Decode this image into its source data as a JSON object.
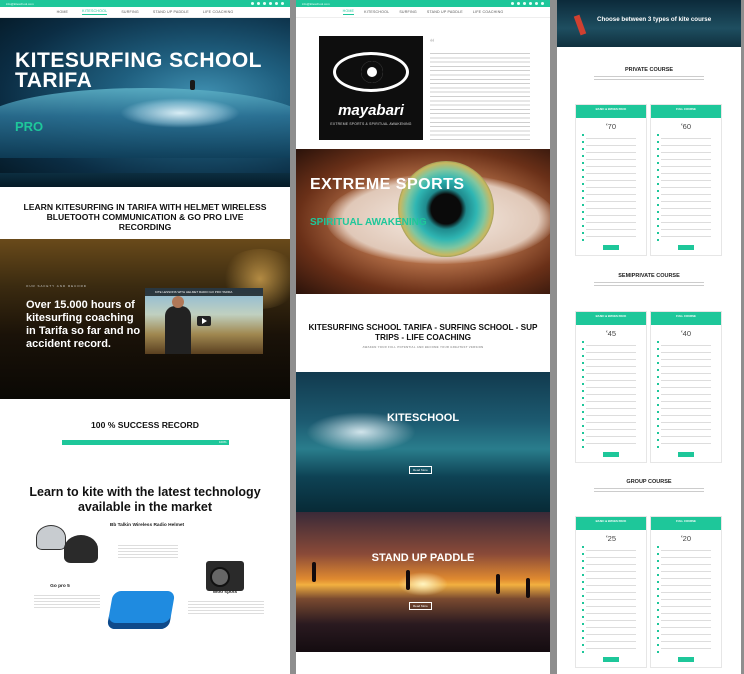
{
  "nav": {
    "email": "info@kiteschool.com",
    "items": [
      "HOME",
      "KITESCHOOL",
      "SURFING",
      "STAND UP PADDLE",
      "LIFE COACHING"
    ],
    "active_index_col1": 1,
    "active_index_col2": 0
  },
  "col1": {
    "hero_title": "KITESURFING SCHOOL TARIFA",
    "hero_pro": "PRO",
    "section_title": "LEARN KITESURFING IN TARIFA WITH HELMET WIRELESS BLUETOOTH COMMUNICATION & GO PRO LIVE RECORDING",
    "video_small": "OUR SAFETY AND RECORD",
    "video_text": "Over 15.000 hours of kitesurfing coaching in Tarifa so far and no accident record.",
    "video_bar_title": "KITE LESSONS WITH HELMET RADIO GO PRO TARIFA",
    "success_title": "100 % SUCCESS RECORD",
    "success_value": 1.0,
    "success_bar_label": "100%",
    "learn_title": "Learn to kite with the latest technology available in the market",
    "products": [
      {
        "name": "Bb Talkin Wireless Radio Helmet"
      },
      {
        "name": "Go pro 5"
      },
      {
        "name": "Woo spots"
      }
    ]
  },
  "col2": {
    "logo_word": "mayabari",
    "logo_tagline": "EXTREME SPORTS & SPIRITUAL AWAKENING",
    "eye_title": "EXTREME SPORTS",
    "eye_subtitle": "SPIRITUAL AWAKENING",
    "section_title": "KITESURFING SCHOOL TARIFA - SURFING SCHOOL - SUP TRIPS - LIFE COACHING",
    "section_sub": "AWAKEN YOUR FULL POTENTIAL AND BECOME YOUR GREATEST VERSION",
    "kite_title": "KITESCHOOL",
    "sup_title": "STAND UP PADDLE",
    "read_more": "Read More"
  },
  "col3": {
    "hero_title": "Choose between 3 types of kite course",
    "courses": [
      {
        "title": "PRIVATE COURSE",
        "prices": [
          {
            "label": "BASIC & WAVES PACK",
            "value": "70"
          },
          {
            "label": "FULL COURSE",
            "value": "60"
          }
        ]
      },
      {
        "title": "SEMIPRIVATE COURSE",
        "prices": [
          {
            "label": "BASIC & WAVES PACK",
            "value": "45"
          },
          {
            "label": "FULL COURSE",
            "value": "40"
          }
        ]
      },
      {
        "title": "GROUP COURSE",
        "prices": [
          {
            "label": "BASIC & WAVES PACK",
            "value": "25"
          },
          {
            "label": "FULL COURSE",
            "value": "20"
          }
        ]
      }
    ],
    "currency": "€"
  },
  "colors": {
    "accent": "#1ec79a",
    "dark": "#111111"
  }
}
